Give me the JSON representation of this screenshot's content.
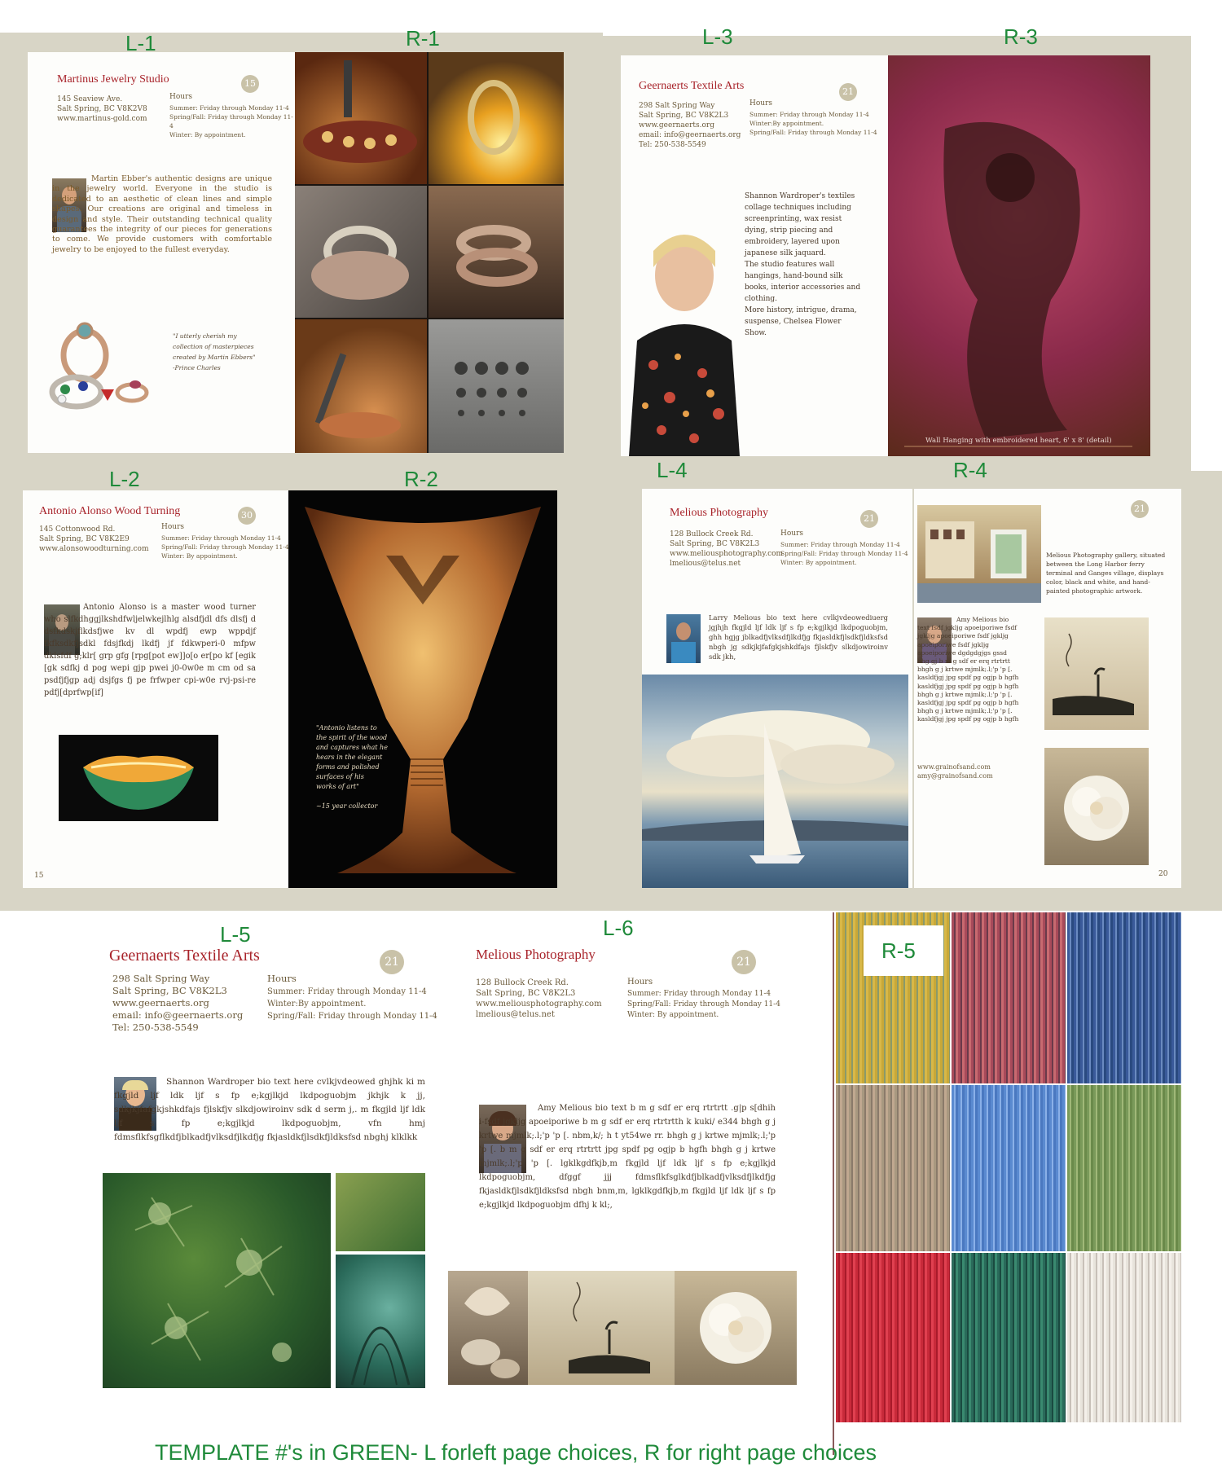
{
  "tags": {
    "l1": "L-1",
    "r1": "R-1",
    "l2": "L-2",
    "r2": "R-2",
    "l3": "L-3",
    "r3": "R-3",
    "l4": "L-4",
    "r4": "R-4",
    "l5": "L-5",
    "l6": "L-6",
    "r5": "R-5"
  },
  "l1": {
    "studio": "Martinus Jewelry Studio",
    "address": "145 Seaview Ave.\nSalt Spring, BC V8K2V8\nwww.martinus-gold.com",
    "hours_title": "Hours",
    "hours": "Summer: Friday through Monday 11-4\nSpring/Fall: Friday through Monday 11-4\nWinter: By appointment.",
    "badge": "15",
    "bio": "Martin Ebber's authentic designs are unique in the jewelry world. Everyone in the studio is dedicated to an aesthetic of clean lines and simple shapes. Our creations are original and timeless in design and style. Their outstanding technical quality guarantees the integrity of our pieces for generations to come. We provide customers with comfortable jewelry to be enjoyed to the fullest everyday.",
    "quote": "\"I utterly cherish my\ncollection of masterpieces\ncreated by Martin Ebbers\"\n-Prince Charles"
  },
  "l3": {
    "studio": "Geernaerts Textile Arts",
    "address": "298 Salt Spring Way\nSalt Spring, BC V8K2L3\nwww.geernaerts.org\nemail: info@geernaerts.org\nTel: 250-538-5549",
    "hours_title": "Hours",
    "hours": "Summer: Friday through Monday 11-4\nWinter:By appointment.\nSpring/Fall: Friday through Monday 11-4",
    "badge": "21",
    "bio": "Shannon Wardroper's textiles collage techniques including screenprinting, wax resist dying, strip piecing and embroidery, layered upon japanese silk jaquard.\nThe studio features wall hangings, hand-bound silk books, interior accessories and clothing.\nMore history, intrigue, drama, suspense, Chelsea Flower Show.",
    "caption": "Wall Hanging with embroidered heart, 6' x 8' (detail)"
  },
  "l2": {
    "studio": "Antonio Alonso Wood Turning",
    "address": "145 Cottonwood Rd.\nSalt Spring, BC V8K2E9\nwww.alonsowoodturning.com",
    "hours_title": "Hours",
    "hours": "Summer: Friday through Monday 11-4\nSpring/Fall: Friday through Monday 11-4\nWinter: By appointment.",
    "badge": "30",
    "bio": "Antonio Alonso is a master wood turner who slfkdhggjlkshdfwljelwkejlhlg alsdfjdl dfs dlsfj d dsfkdskjflkdsfjwe kv dl wpdfj ewp wppdjf fkfksdkfjsdkl fdsjfkdj lkdfj jf fdkwperi-0 mfpw dklsfdf g;klr[ grp gfg [rpg[pot ew]]o[o er[po kf [egik [gk sdfkj d pog wepi gjp pwei j0-0w0e m cm od sa psdfjfjgp adj dsjfgs fj pe frfwper cpi-w0e rvj-psi-re pdfj[dprfwp[if]",
    "quote": "\"Antonio listens to\nthe spirit of the wood\nand captures what he\nhears in the elegant\nforms and polished\nsurfaces of his\nworks of art\"\n\n~15 year collector",
    "page_num": "15"
  },
  "l4": {
    "studio": "Melious Photography",
    "address": "128 Bullock Creek Rd.\nSalt Spring, BC V8K2L3\nwww.meliousphotography.com\nlmelious@telus.net",
    "hours_title": "Hours",
    "hours": "Summer: Friday through Monday 11-4\nSpring/Fall: Friday through Monday 11-4\nWinter: By appointment.",
    "badge": "21",
    "bio": "Larry Melious bio text here cvlkjvdeowediuerg jgjhjh fkgjld ljf ldk ljf s fp e;kgjlkjd lkdpoguobjm, ghh hgjg jblkadfjvlksdfjlkdfjg fkjasldkfjlsdkfjldksfsd nbgh jg sdkjkjfafgkjshkdfajs fjlskfjv slkdjowiroinv sdk jkh,"
  },
  "r4": {
    "badge": "21",
    "gallery": "Melious Photography gallery, situated between the Long Harbor ferry terminal and Ganges village, displays color, black and white, and hand-painted photographic artwork.",
    "bio": "Amy Melious bio text fsdf jgkljg apoeiporiwe fsdf jgkljg apoeiporiwe fsdf jgkljg apoeiporiwe fsdf jgkljg apoeiporiwe dgdgdgjgs gssd hhg gj b m g sdf er erq rtrtrtt bhgh g j krtwe mjmlk;.l;'p 'p [. kasldfjgj jpg spdf pg ogjp b hgfh kasldfjgj jpg spdf pg ogjp b hgfh bhgh g j krtwe mjmlk;.l;'p 'p [. kasldfjgj jpg spdf pg ogjp b hgfh bhgh g j krtwe mjmlk;.l;'p 'p [. kasldfjgj jpg spdf pg ogjp b hgfh",
    "links": "www.grainofsand.com\namy@grainofsand.com",
    "page_num": "20"
  },
  "l5": {
    "studio": "Geernaerts Textile Arts",
    "address": "298 Salt Spring Way\nSalt Spring, BC V8K2L3\nwww.geernaerts.org\nemail: info@geernaerts.org\nTel: 250-538-5549",
    "hours_title": "Hours",
    "hours": "Summer: Friday through Monday 11-4\nWinter:By appointment.\nSpring/Fall: Friday through Monday 11-4",
    "badge": "21",
    "bio": "Shannon Wardroper bio text here cvlkjvdeowed ghjhk ki m fkgjld ljf ldk ljf s fp e;kgjlkjd lkdpoguobjm jkhjk k jj, sdkjkjfafgkjshkdfajs fjlskfjv slkdjowiroinv sdk d serm j,. m fkgjld ljf ldk ljf s fp e;kgjlkjd lkdpoguobjm, vfn hmj fdmsflkfsgflkdfjblkadfjvlksdfjlkdfjg fkjasldkfjlsdkfjldksfsd nbghj klklkk"
  },
  "l6": {
    "studio": "Melious Photography",
    "address": "128 Bullock Creek Rd.\nSalt Spring, BC V8K2L3\nwww.meliousphotography.com\nlmelious@telus.net",
    "hours_title": "Hours",
    "hours": "Summer: Friday through Monday 11-4\nSpring/Fall: Friday through Monday 11-4\nWinter: By appointment.",
    "badge": "21",
    "bio": "Amy Melious bio text b m g sdf er erq rtrtrtt .g|p s[dhih i-fsdf jgkljg apoeiporiwe b m g sdf er erq rtrtrtth k kuki/ e344 bhgh g j krtwe mjmlk;.l;'p 'p [. nbm,k/; h t yt54we rr. bhgh g j krtwe mjmlk;.l;'p 'p [. b m g sdf er erq rtrtrtt jpg spdf pg ogjp b hgfh bhgh g j krtwe mjmlk;.l;'p 'p [. lgklkgdfkjb,m fkgjld ljf ldk ljf s fp e;kgjlkjd lkdpoguobjm, dfggf jjj fdmsflkfsglkdfjblkadfjvlksdfjlkdfjg fkjasldkfjlsdkfjldksfsd nbgh bnm,m, lgklkgdfkjb,m fkgjld ljf ldk ljf s fp e;kgjlkjd lkdpoguobjm dfhj k kl;,"
  },
  "footer": "TEMPLATE #'s in GREEN- L forleft page choices, R for right page choices",
  "colors": {
    "template_tag": "#1f8a3a",
    "studio_name": "#a8232a",
    "panel": "#d8d5c6"
  }
}
